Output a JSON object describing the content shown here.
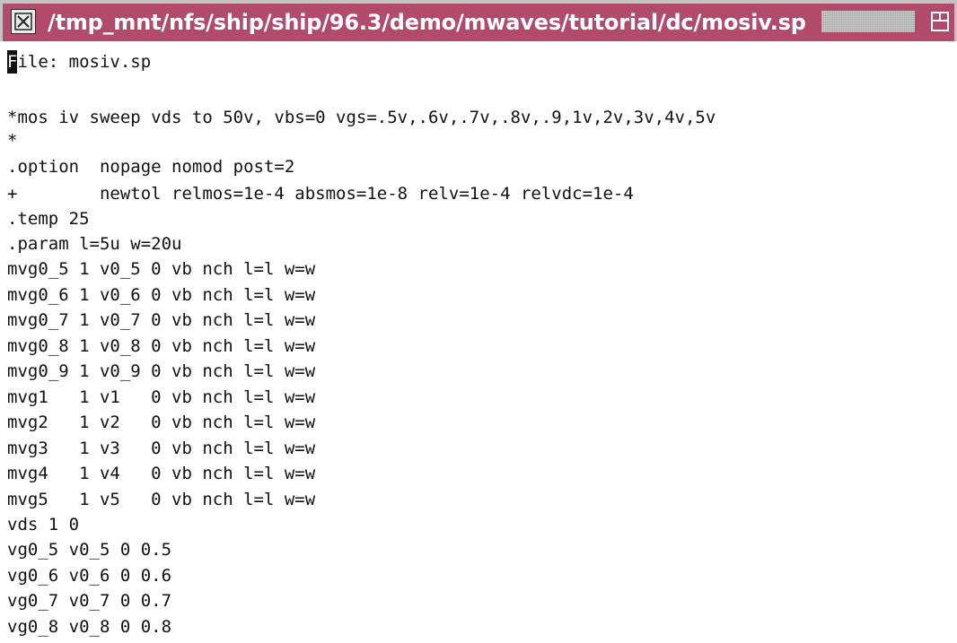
{
  "window": {
    "title": "/tmp_mnt/nfs/ship/ship/96.3/demo/mwaves/tutorial/dc/mosiv.sp"
  },
  "editor": {
    "status": {
      "cursor_char": "F",
      "rest": "ile: mosiv.sp"
    },
    "lines": [
      "*mos iv sweep vds to 50v, vbs=0 vgs=.5v,.6v,.7v,.8v,.9,1v,2v,3v,4v,5v",
      "*",
      ".option  nopage nomod post=2",
      "+        newtol relmos=1e-4 absmos=1e-8 relv=1e-4 relvdc=1e-4",
      ".temp 25",
      ".param l=5u w=20u",
      "mvg0_5 1 v0_5 0 vb nch l=l w=w",
      "mvg0_6 1 v0_6 0 vb nch l=l w=w",
      "mvg0_7 1 v0_7 0 vb nch l=l w=w",
      "mvg0_8 1 v0_8 0 vb nch l=l w=w",
      "mvg0_9 1 v0_9 0 vb nch l=l w=w",
      "mvg1   1 v1   0 vb nch l=l w=w",
      "mvg2   1 v2   0 vb nch l=l w=w",
      "mvg3   1 v3   0 vb nch l=l w=w",
      "mvg4   1 v4   0 vb nch l=l w=w",
      "mvg5   1 v5   0 vb nch l=l w=w",
      "vds 1 0",
      "vg0_5 v0_5 0 0.5",
      "vg0_6 v0_6 0 0.6",
      "vg0_7 v0_7 0 0.7",
      "vg0_8 v0_8 0 0.8"
    ]
  },
  "colors": {
    "titlebar": "#b24a6c",
    "text": "#111111",
    "background": "#ffffff"
  },
  "icons": {
    "window_menu": "x-window-menu-icon",
    "maximize": "maximize-icon"
  }
}
